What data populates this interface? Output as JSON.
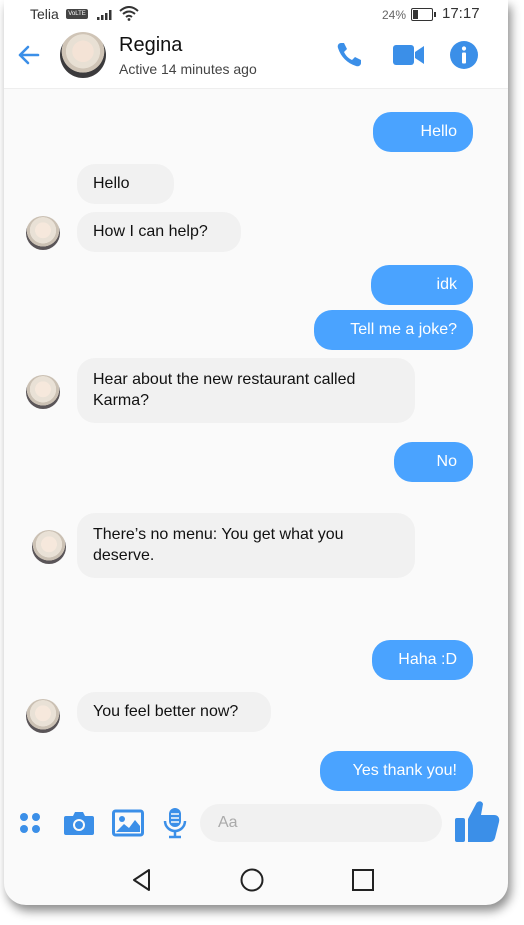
{
  "status": {
    "carrier": "Telia",
    "volte": "VoLTE",
    "battery": "24%",
    "time": "17:17"
  },
  "header": {
    "name": "Regina",
    "active": "Active 14 minutes ago"
  },
  "messages": [
    {
      "side": "out",
      "text": "Hello"
    },
    {
      "side": "in",
      "text": "Hello"
    },
    {
      "side": "in",
      "text": "How I can help?"
    },
    {
      "side": "out",
      "text": "idk"
    },
    {
      "side": "out",
      "text": "Tell me a joke?"
    },
    {
      "side": "in",
      "text": "Hear about the new restaurant called Karma?"
    },
    {
      "side": "out",
      "text": "No"
    },
    {
      "side": "in",
      "text": "There’s no menu: You get what you deserve."
    },
    {
      "side": "out",
      "text": "Haha :D"
    },
    {
      "side": "in",
      "text": "You feel better now?"
    },
    {
      "side": "out",
      "text": "Yes thank you!"
    }
  ],
  "composer": {
    "placeholder": "Aa"
  },
  "colors": {
    "accent": "#4aa3ff",
    "outgoing_bubble": "#4aa3ff",
    "incoming_bubble": "#f1f1f1"
  },
  "icons": {
    "header": [
      "back-arrow-icon",
      "phone-icon",
      "video-camera-icon",
      "info-icon"
    ],
    "composer": [
      "grid-dots-icon",
      "camera-icon",
      "image-icon",
      "microphone-icon",
      "thumbs-up-icon"
    ],
    "navigation": [
      "nav-back-icon",
      "nav-home-icon",
      "nav-recents-icon"
    ]
  }
}
